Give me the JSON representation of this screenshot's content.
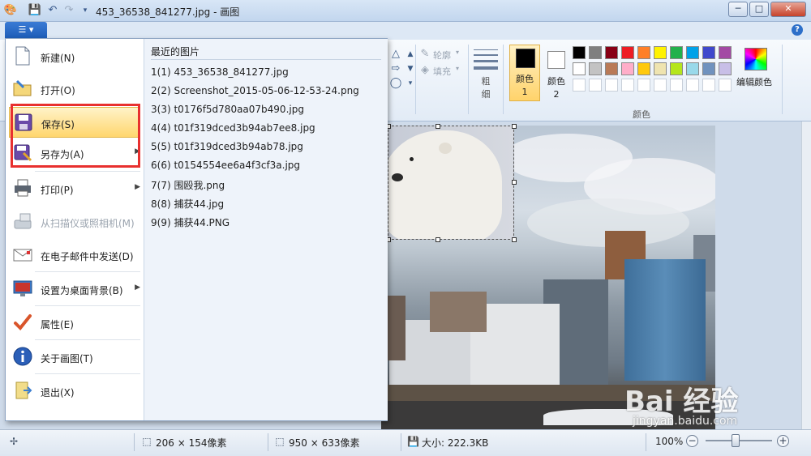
{
  "window": {
    "title": "453_36538_841277.jpg - 画图",
    "minimize": "─",
    "maximize": "□",
    "close": "✕"
  },
  "ribbon": {
    "outline_label": "轮廓",
    "fill_label": "填充",
    "size_label": "粗细",
    "color1_label": "颜色 1",
    "color2_label": "颜色 2",
    "edit_colors_label": "编辑颜色",
    "group_colors": "颜色",
    "color1": "#000000",
    "color2": "#ffffff",
    "palette_row1": [
      "#000000",
      "#7f7f7f",
      "#880015",
      "#ed1c24",
      "#ff7f27",
      "#fff200",
      "#22b14c",
      "#00a2e8",
      "#3f48cc",
      "#a349a4"
    ],
    "palette_row2": [
      "#ffffff",
      "#c3c3c3",
      "#b97a57",
      "#ffaec9",
      "#ffc90e",
      "#efe4b0",
      "#b5e61d",
      "#99d9ea",
      "#7092be",
      "#c8bfe7"
    ]
  },
  "menu": {
    "items": [
      {
        "label": "新建(N)",
        "icon": "new-file-icon"
      },
      {
        "label": "打开(O)",
        "icon": "open-folder-icon"
      },
      {
        "label": "保存(S)",
        "icon": "save-disk-icon"
      },
      {
        "label": "另存为(A)",
        "icon": "save-as-icon"
      },
      {
        "label": "打印(P)",
        "icon": "printer-icon"
      },
      {
        "label": "从扫描仪或照相机(M)",
        "icon": "scanner-icon"
      },
      {
        "label": "在电子邮件中发送(D)",
        "icon": "email-icon"
      },
      {
        "label": "设置为桌面背景(B)",
        "icon": "desktop-background-icon"
      },
      {
        "label": "属性(E)",
        "icon": "properties-check-icon"
      },
      {
        "label": "关于画图(T)",
        "icon": "info-icon"
      },
      {
        "label": "退出(X)",
        "icon": "exit-icon"
      }
    ],
    "recent_title": "最近的图片",
    "recent": [
      "1(1)  453_36538_841277.jpg",
      "2(2)  Screenshot_2015-05-06-12-53-24.png",
      "3(3)  t0176f5d780aa07b490.jpg",
      "4(4)  t01f319dced3b94ab7ee8.jpg",
      "5(5)  t01f319dced3b94ab78.jpg",
      "6(6)  t0154554ee6a4f3cf3a.jpg",
      "7(7)  围殴我.png",
      "8(8)  捕获44.jpg",
      "9(9)  捕获44.PNG"
    ]
  },
  "status": {
    "selection_size": "206 × 154像素",
    "image_size": "950 × 633像素",
    "file_size": "大小: 222.3KB",
    "zoom": "100%"
  },
  "watermark": {
    "logo": "Bai 经验",
    "url": "jingyan.baidu.com"
  }
}
